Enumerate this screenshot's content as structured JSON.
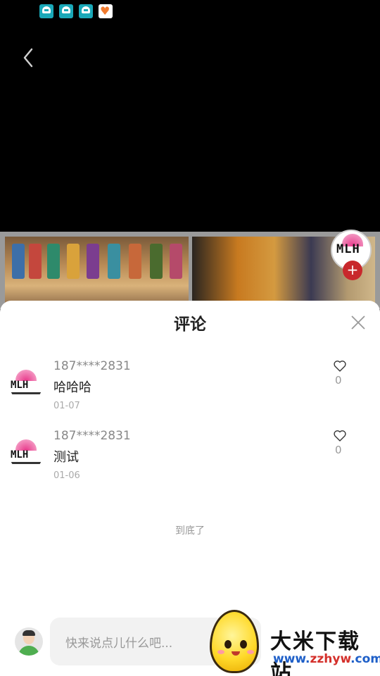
{
  "status_bar": {
    "icons": [
      "app-notification-icon",
      "app-notification-icon",
      "app-notification-icon",
      "heart-app-icon"
    ]
  },
  "header": {
    "back_icon": "chevron-left-icon"
  },
  "video": {
    "brand_avatar_text": "MLH",
    "follow_label": "+"
  },
  "comments_sheet": {
    "title": "评论",
    "close_icon": "close-icon",
    "comments": [
      {
        "user": "187****2831",
        "text": "哈哈哈",
        "date": "01-07",
        "likes": "0"
      },
      {
        "user": "187****2831",
        "text": "测试",
        "date": "01-06",
        "likes": "0"
      }
    ],
    "end_text": "到底了",
    "input_placeholder": "快来说点儿什么吧..."
  },
  "watermark": {
    "title": "大米下载站",
    "url_prefix": "www.",
    "url_brand": "zzhyw",
    "url_suffix": ".com"
  },
  "colors": {
    "accent_red": "#c8282c",
    "brand_pink": "#e8378a"
  }
}
